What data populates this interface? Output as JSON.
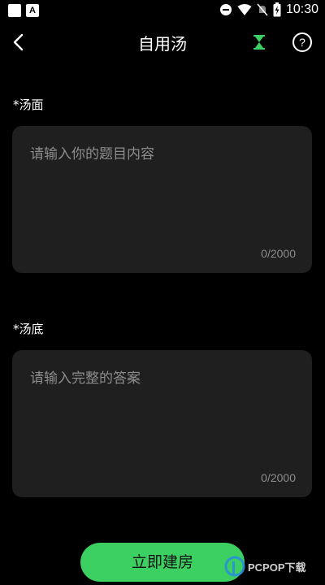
{
  "status_bar": {
    "left_icon_1": "square-icon",
    "left_icon_2_label": "A",
    "time": "10:30",
    "icons": [
      "do-not-disturb-icon",
      "wifi-icon",
      "mute-icon",
      "battery-charging-icon"
    ]
  },
  "header": {
    "back_icon": "chevron-left-icon",
    "title": "自用汤",
    "hourglass_icon": "hourglass-icon",
    "help_label": "?"
  },
  "question": {
    "label": "*汤面",
    "placeholder": "请输入你的题目内容",
    "value": "",
    "counter": "0/2000"
  },
  "answer": {
    "label": "*汤底",
    "placeholder": "请输入完整的答案",
    "value": "",
    "counter": "0/2000"
  },
  "actions": {
    "create_label": "立即建房"
  },
  "watermark": {
    "text": "PCPOP下载"
  },
  "colors": {
    "background": "#000000",
    "card": "#1f1f1f",
    "accent": "#3ccf62",
    "placeholder": "#8c8c8c"
  }
}
